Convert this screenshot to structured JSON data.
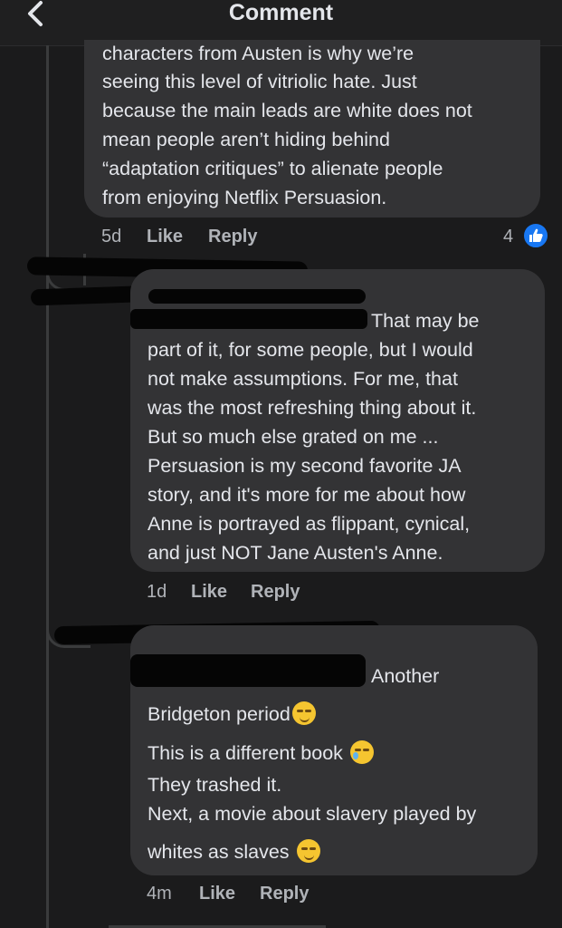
{
  "header": {
    "title": "Comment",
    "back_icon": "chevron-left-icon"
  },
  "comment1": {
    "lines": [
      "characters from Austen is why we’re",
      "seeing this level of vitriolic hate. Just",
      "because the main leads are white does not",
      "mean people aren’t hiding behind",
      "“adaptation critiques” to alienate people",
      "from enjoying Netflix Persuasion."
    ],
    "time": "5d",
    "like_label": "Like",
    "reply_label": "Reply",
    "like_count": "4"
  },
  "comment2": {
    "lines": [
      "That may be",
      "part of it, for some people, but I would",
      "not make assumptions. For me, that",
      "was the most refreshing thing about it.",
      "But so much else grated on me ...",
      "Persuasion is my second favorite JA",
      "story, and it's more for me about how",
      "Anne is portrayed as flippant, cynical,",
      "and just NOT Jane Austen's Anne."
    ],
    "time": "1d",
    "like_label": "Like",
    "reply_label": "Reply"
  },
  "comment3": {
    "lines": [
      "Another",
      "Bridgeton period",
      "This is a different book",
      "They trashed it.",
      "Next, a movie about slavery played by",
      "whites as slaves"
    ],
    "emojis": [
      "smirking-face-emoji",
      "crying-face-emoji",
      "smirking-face-emoji"
    ],
    "time": "4m",
    "like_label": "Like",
    "reply_label": "Reply"
  }
}
